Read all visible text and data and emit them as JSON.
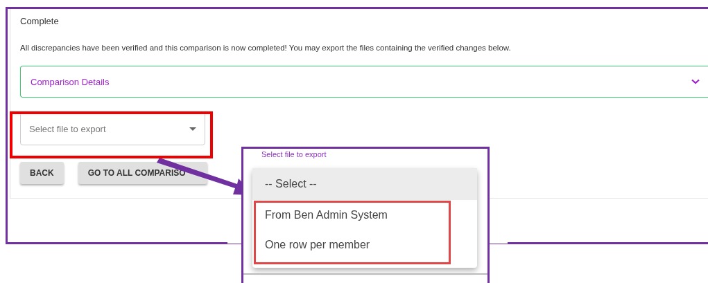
{
  "card": {
    "title": "Complete",
    "message": "All discrepancies have been verified and this comparison is now completed! You may export the files containing the verified changes below.",
    "accordion": {
      "title": "Comparison Details",
      "expanded": false
    },
    "select": {
      "placeholder": "Select file to export"
    },
    "buttons": [
      {
        "label": "BACK"
      },
      {
        "label": "GO TO ALL COMPARISO"
      }
    ]
  },
  "zoom_inset": {
    "field_label": "Select file to export",
    "options": [
      {
        "label": "-- Select --",
        "selected": true
      },
      {
        "label": "From Ben Admin System",
        "selected": false
      },
      {
        "label": "One row per member",
        "selected": false
      }
    ]
  }
}
